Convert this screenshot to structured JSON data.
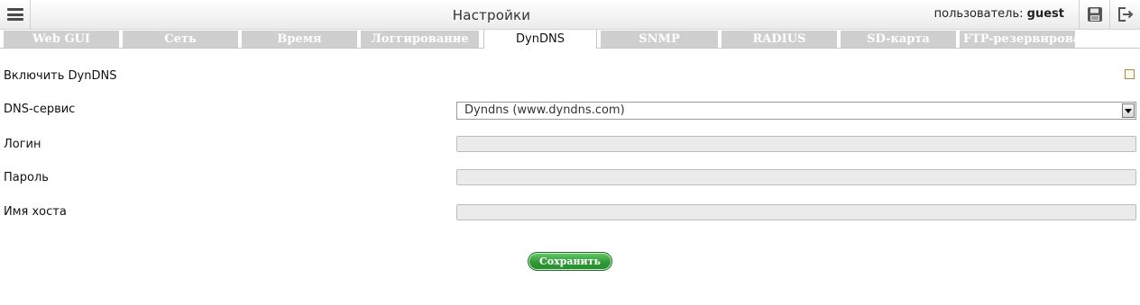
{
  "header": {
    "title": "Настройки",
    "user_prefix": "пользователь:",
    "user_name": "guest",
    "menu_icon": "menu-icon",
    "save_icon": "floppy-disk-icon",
    "logout_icon": "logout-icon"
  },
  "tabs": [
    {
      "label": "Web GUI",
      "active": false
    },
    {
      "label": "Сеть",
      "active": false
    },
    {
      "label": "Время",
      "active": false
    },
    {
      "label": "Логгирование",
      "active": false
    },
    {
      "label": "DynDNS",
      "active": true
    },
    {
      "label": "SNMP",
      "active": false
    },
    {
      "label": "RADIUS",
      "active": false
    },
    {
      "label": "SD-карта",
      "active": false
    },
    {
      "label": "FTP-резервирование",
      "active": false
    }
  ],
  "form": {
    "enable_label": "Включить DynDNS",
    "enable_checked": false,
    "service_label": "DNS-сервис",
    "service_value": "Dyndns (www.dyndns.com)",
    "login_label": "Логин",
    "login_value": "",
    "password_label": "Пароль",
    "password_value": "",
    "host_label": "Имя хоста",
    "host_value": "",
    "save_button": "Сохранить"
  },
  "colors": {
    "tab_inactive": "#cfcfcf",
    "save_green": "#2f9a36"
  }
}
